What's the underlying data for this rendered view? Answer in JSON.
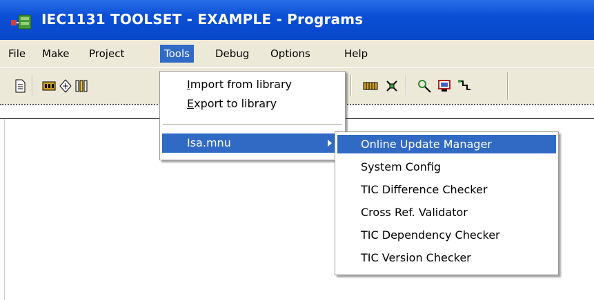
{
  "window": {
    "title": "IEC1131 TOOLSET - EXAMPLE - Programs",
    "icon": "app-icon",
    "titlebar_color": "#0a4fd6"
  },
  "menubar": {
    "items": [
      {
        "label": "File"
      },
      {
        "label": "Make"
      },
      {
        "label": "Project"
      },
      {
        "label": "Tools"
      },
      {
        "label": "Debug"
      },
      {
        "label": "Options"
      },
      {
        "label": "Help"
      }
    ],
    "active": "Tools"
  },
  "toolbar": {
    "icons": [
      "new-document-icon",
      "build-icon",
      "compile-icon",
      "program-icon",
      "library-icon",
      "network-icon",
      "debug-icon",
      "monitor-icon",
      "connection-icon"
    ]
  },
  "tools_menu": {
    "items": [
      {
        "mnemonic": "I",
        "rest": "mport from library"
      },
      {
        "mnemonic": "E",
        "rest": "xport to library"
      },
      {
        "label": "Isa.mnu",
        "has_submenu": true
      }
    ]
  },
  "isa_submenu": {
    "items": [
      {
        "label": "Online Update Manager"
      },
      {
        "label": "System Config"
      },
      {
        "label": "TIC Difference Checker"
      },
      {
        "label": "Cross Ref. Validator"
      },
      {
        "label": "TIC Dependency Checker"
      },
      {
        "label": "TIC Version Checker"
      }
    ],
    "highlight_color": "#316ac5"
  }
}
